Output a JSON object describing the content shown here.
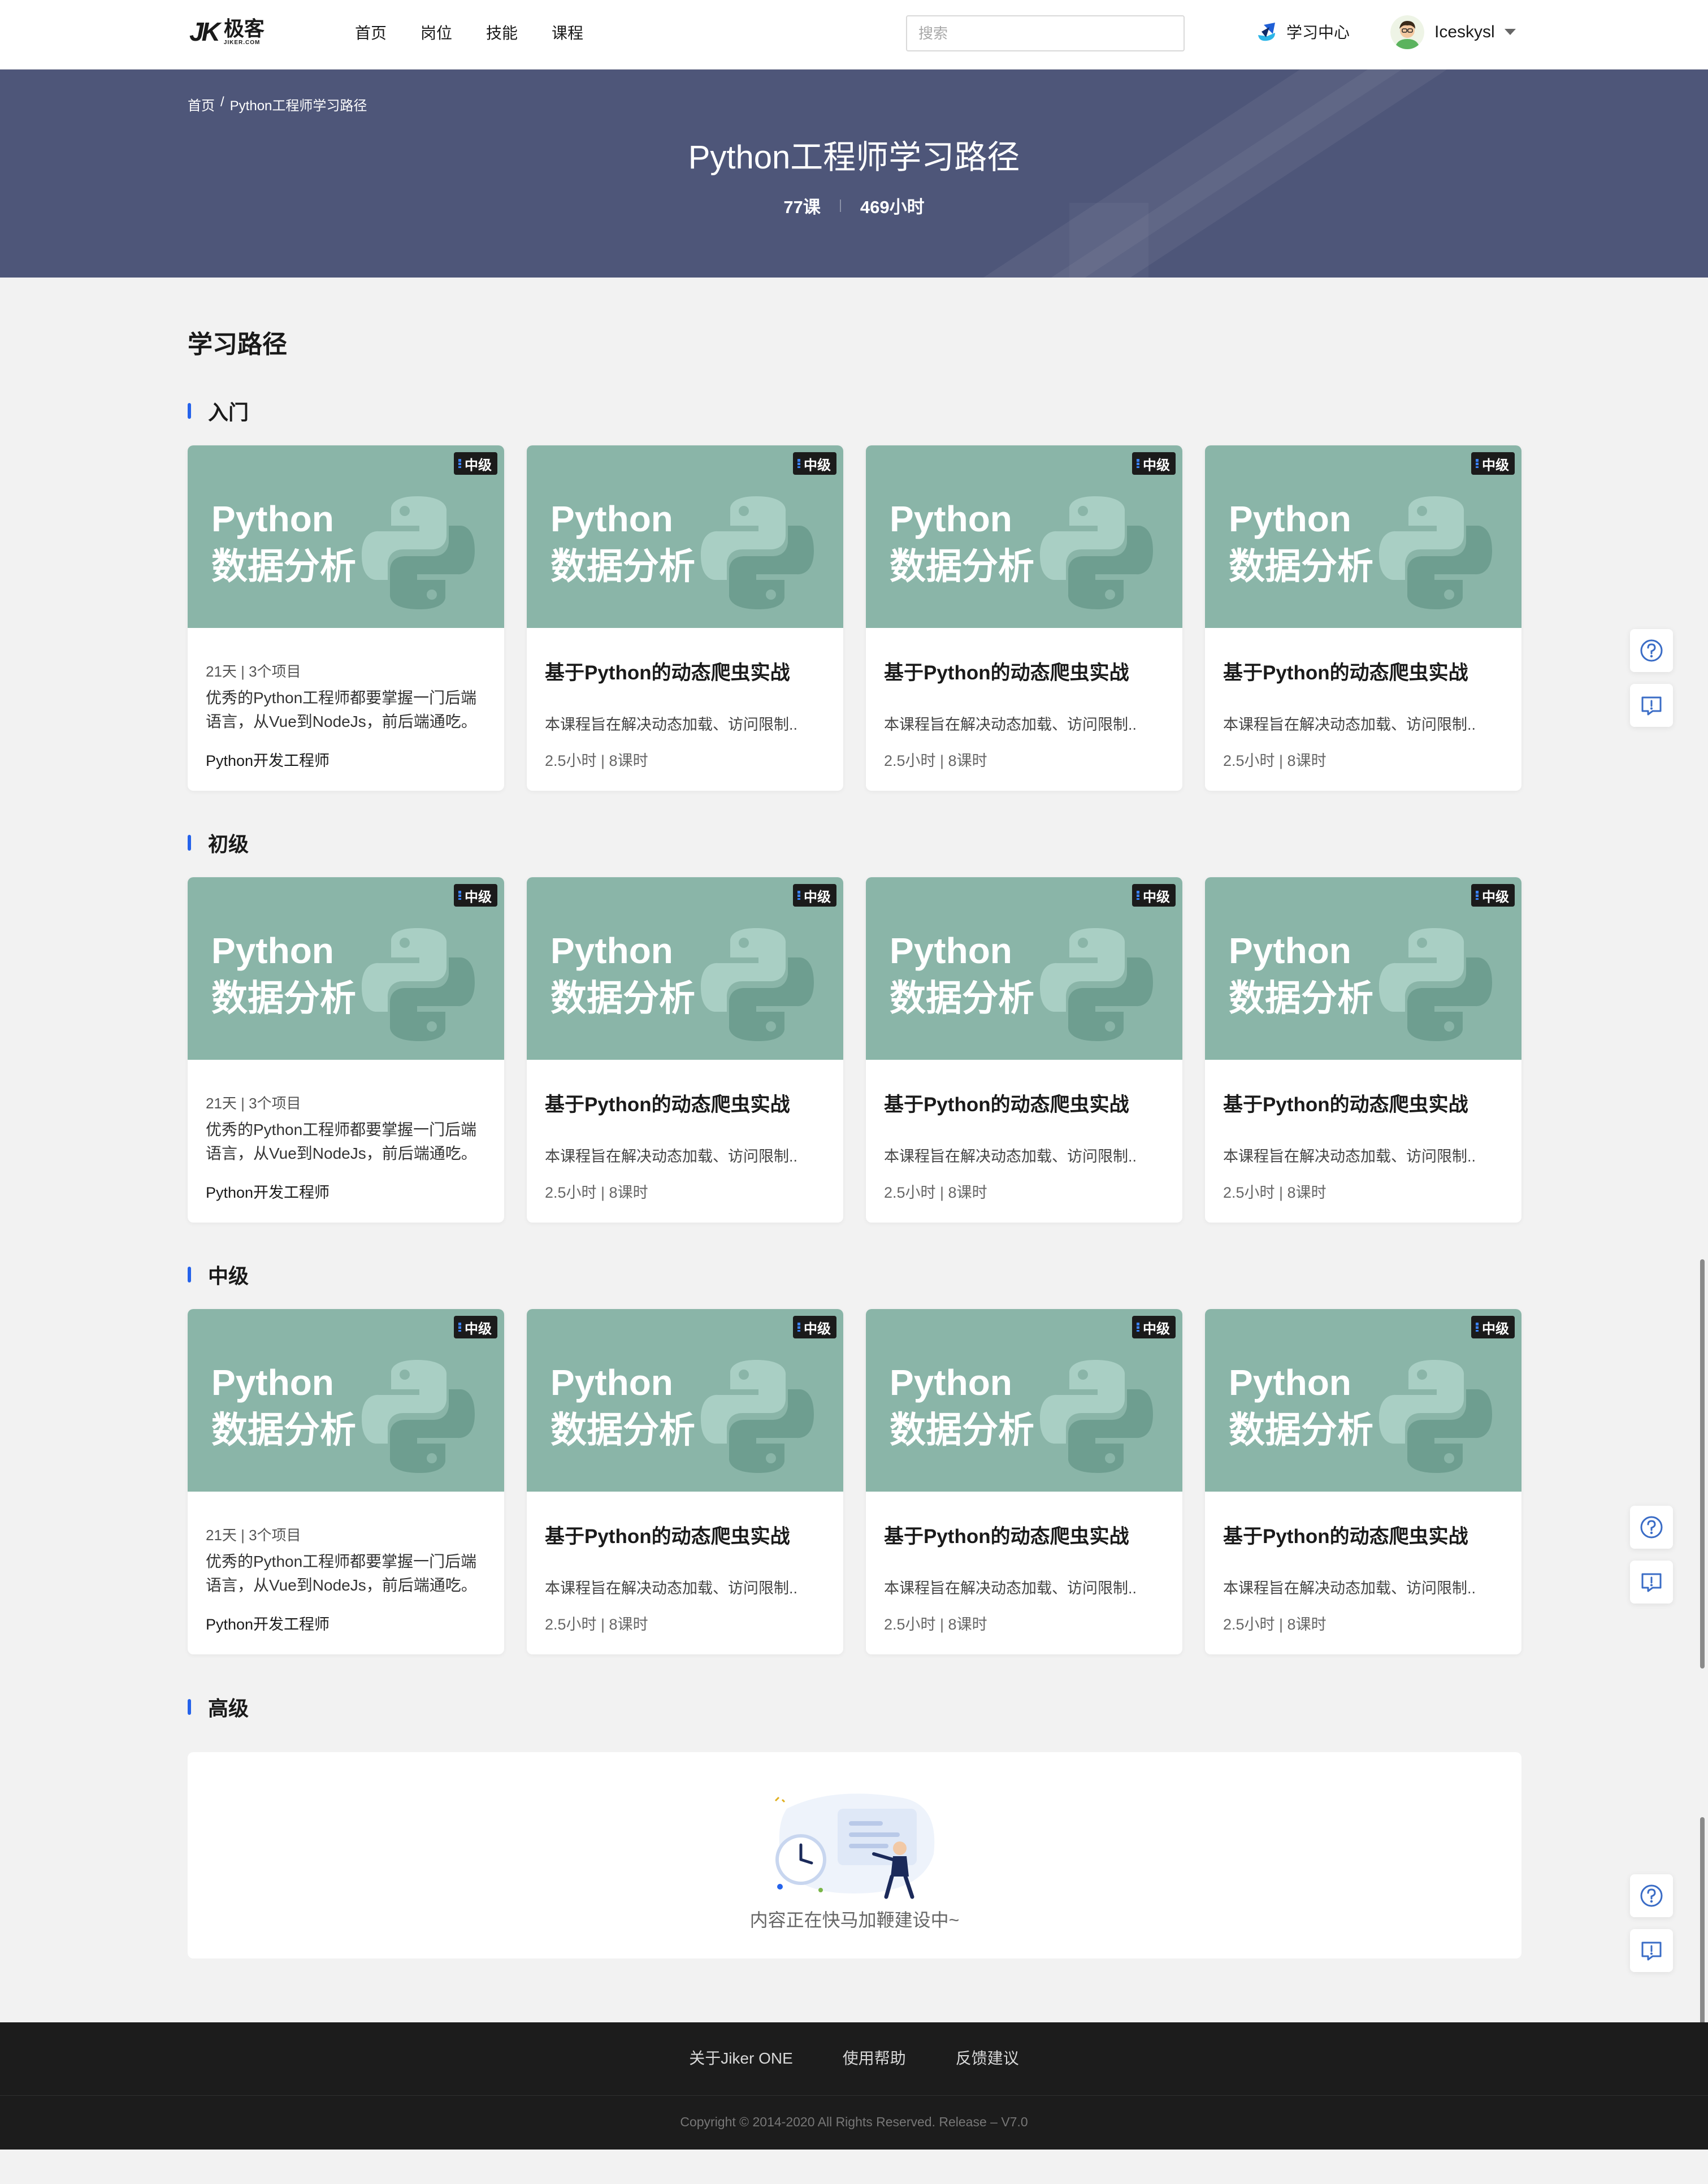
{
  "logo": {
    "mark": "JK",
    "text": "极客",
    "sub": "JIKER.COM"
  },
  "nav": {
    "items": [
      "首页",
      "岗位",
      "技能",
      "课程"
    ]
  },
  "search": {
    "placeholder": "搜索"
  },
  "study_center": {
    "label": "学习中心"
  },
  "user": {
    "name": "Iceskysl"
  },
  "breadcrumb": {
    "home": "首页",
    "sep": "/",
    "current": "Python工程师学习路径"
  },
  "banner": {
    "title": "Python工程师学习路径",
    "lessons": "77课",
    "hours": "469小时"
  },
  "section_title": "学习路径",
  "cover": {
    "line1": "Python",
    "line2": "数据分析",
    "badge": "中级"
  },
  "path_card": {
    "meta": "21天 | 3个项目",
    "desc": "优秀的Python工程师都要掌握一门后端语言，从Vue到NodeJs，前后端通吃。",
    "tag": "Python开发工程师"
  },
  "course_card": {
    "title": "基于Python的动态爬虫实战",
    "desc": "本课程旨在解决动态加载、访问限制..",
    "stats": "2.5小时 | 8课时"
  },
  "levels": [
    "入门",
    "初级",
    "中级",
    "高级"
  ],
  "empty": {
    "text": "内容正在快马加鞭建设中~"
  },
  "footer": {
    "links": [
      "关于Jiker ONE",
      "使用帮助",
      "反馈建议"
    ],
    "copyright": "Copyright © 2014-2020 All Rights Reserved. Release – V7.0"
  },
  "colors": {
    "banner": "#4e5679",
    "cover": "#8ab5a8",
    "accent": "#2563eb",
    "footer": "#1c1c1c"
  },
  "icons": [
    "search-icon",
    "study-center-icon",
    "avatar",
    "chevron-down-icon",
    "python-logo-icon",
    "help-icon",
    "feedback-icon"
  ]
}
